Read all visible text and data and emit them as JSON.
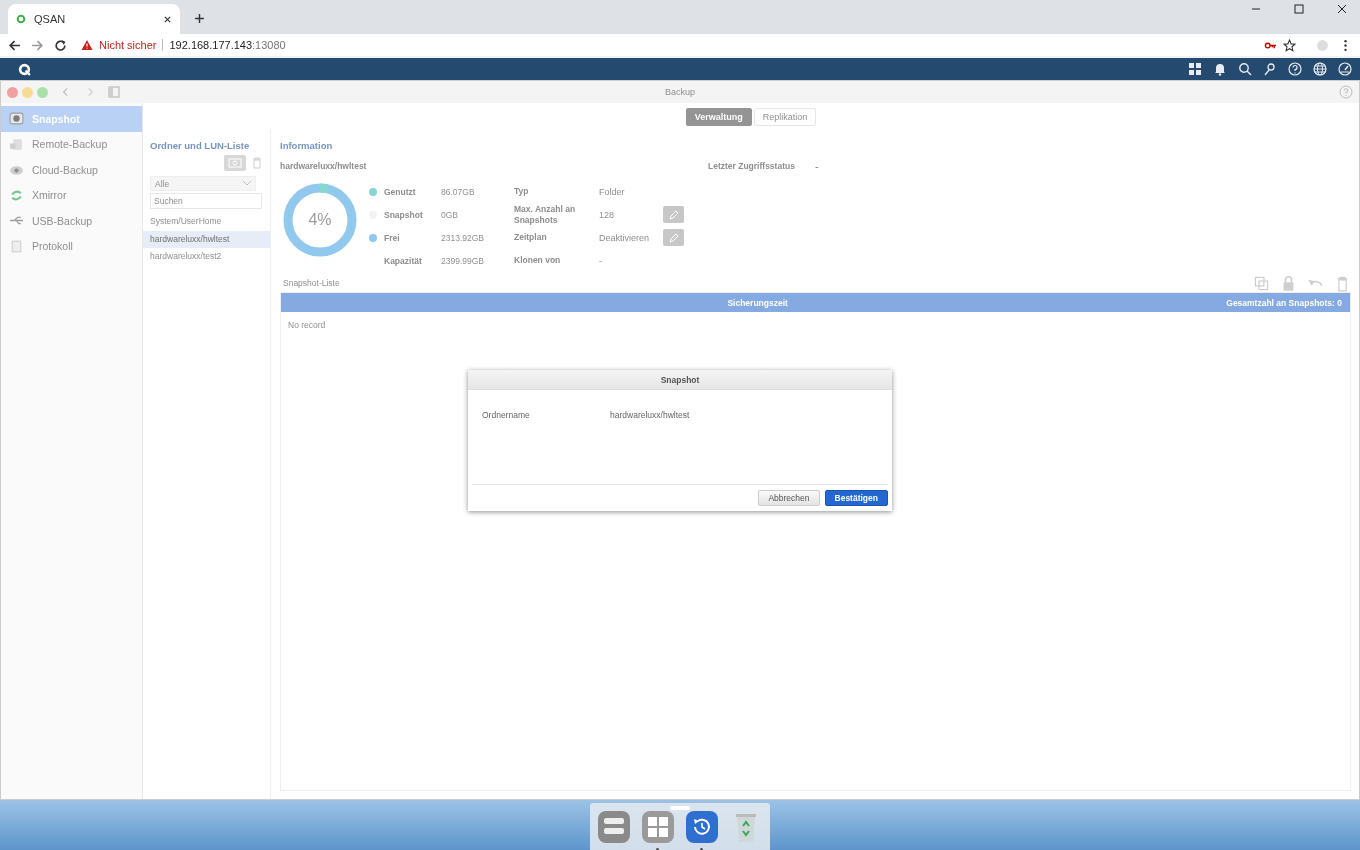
{
  "browser": {
    "tab_title": "QSAN",
    "security": "Nicht sicher",
    "url_host": "192.168.177.143",
    "url_port": ":13080"
  },
  "app": {
    "title": "Backup",
    "tabs": [
      {
        "label": "Verwaltung",
        "selected": true
      },
      {
        "label": "Replikation",
        "selected": false
      }
    ]
  },
  "sidebar": {
    "items": [
      {
        "label": "Snapshot",
        "selected": true
      },
      {
        "label": "Remote-Backup",
        "selected": false
      },
      {
        "label": "Cloud-Backup",
        "selected": false
      },
      {
        "label": "Xmirror",
        "selected": false
      },
      {
        "label": "USB-Backup",
        "selected": false
      },
      {
        "label": "Protokoll",
        "selected": false
      }
    ]
  },
  "folder_panel": {
    "title": "Ordner und LUN-Liste",
    "filter": "Alle",
    "search_placeholder": "Suchen",
    "folders": [
      {
        "name": "System/UserHome",
        "selected": false
      },
      {
        "name": "hardwareluxx/hwltest",
        "selected": true
      },
      {
        "name": "hardwareluxx/test2",
        "selected": false
      }
    ]
  },
  "information": {
    "title": "Information",
    "folder": "hardwareluxx/hwltest",
    "usage": {
      "label": "4%",
      "level": 0.04
    },
    "legend": [
      {
        "label": "Genutzt",
        "value": "86.07GB",
        "color": "#80d4cf"
      },
      {
        "label": "Snapshot",
        "value": "0GB",
        "color": "#f2f2f2"
      },
      {
        "label": "Frei",
        "value": "2313.92GB",
        "color": "#8cc6ee"
      },
      {
        "label": "Kapazität",
        "value": "2399.99GB"
      }
    ],
    "properties": [
      {
        "label": "Typ",
        "value": "Folder",
        "editable": false
      },
      {
        "label": "Max. Anzahl an Snapshots",
        "value": "128",
        "editable": true
      },
      {
        "label": "Zeitplan",
        "value": "Deaktivieren",
        "editable": true
      },
      {
        "label": "Klonen von",
        "value": "-",
        "editable": false
      }
    ],
    "last_access": {
      "label": "Letzter Zugriffsstatus",
      "value": "-"
    }
  },
  "snapshot_list": {
    "title": "Snapshot-Liste",
    "columns": [
      "Sicherungszeit"
    ],
    "total": "Gesamtzahl an Snapshots: 0",
    "empty": "No record"
  },
  "dialog": {
    "title": "Snapshot",
    "fields": [
      {
        "label": "Ordnername",
        "value": "hardwareluxx/hwltest"
      }
    ],
    "buttons": [
      {
        "label": "Abbrechen",
        "kind": "secondary"
      },
      {
        "label": "Bestätigen",
        "kind": "primary"
      }
    ]
  },
  "dock": [
    {
      "running": false
    },
    {
      "running": true
    },
    {
      "running": true
    },
    {
      "running": false
    }
  ]
}
